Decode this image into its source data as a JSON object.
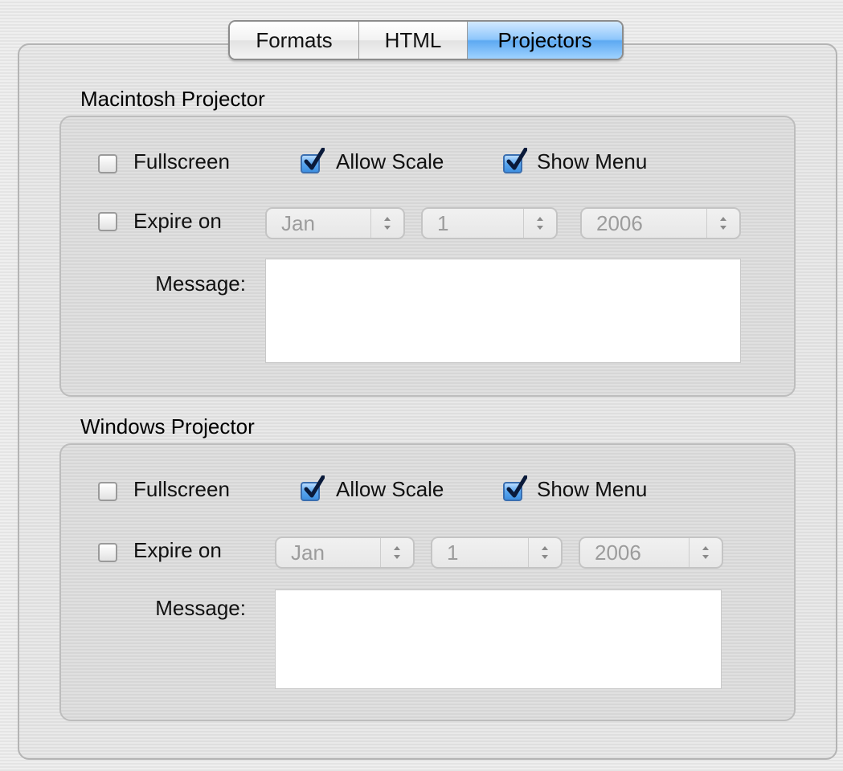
{
  "tabs": [
    {
      "label": "Formats",
      "active": false
    },
    {
      "label": "HTML",
      "active": false
    },
    {
      "label": "Projectors",
      "active": true
    }
  ],
  "mac": {
    "title": "Macintosh Projector",
    "fullscreen": {
      "label": "Fullscreen",
      "checked": false
    },
    "allow_scale": {
      "label": "Allow Scale",
      "checked": true
    },
    "show_menu": {
      "label": "Show Menu",
      "checked": true
    },
    "expire": {
      "label": "Expire on",
      "checked": false,
      "month": "Jan",
      "day": "1",
      "year": "2006"
    },
    "message_label": "Message:",
    "message_value": ""
  },
  "win": {
    "title": "Windows Projector",
    "fullscreen": {
      "label": "Fullscreen",
      "checked": false
    },
    "allow_scale": {
      "label": "Allow Scale",
      "checked": true
    },
    "show_menu": {
      "label": "Show Menu",
      "checked": true
    },
    "expire": {
      "label": "Expire on",
      "checked": false,
      "month": "Jan",
      "day": "1",
      "year": "2006"
    },
    "message_label": "Message:",
    "message_value": ""
  },
  "colors": {
    "accent": "#5da9f2",
    "check": "#0a1a3a"
  }
}
